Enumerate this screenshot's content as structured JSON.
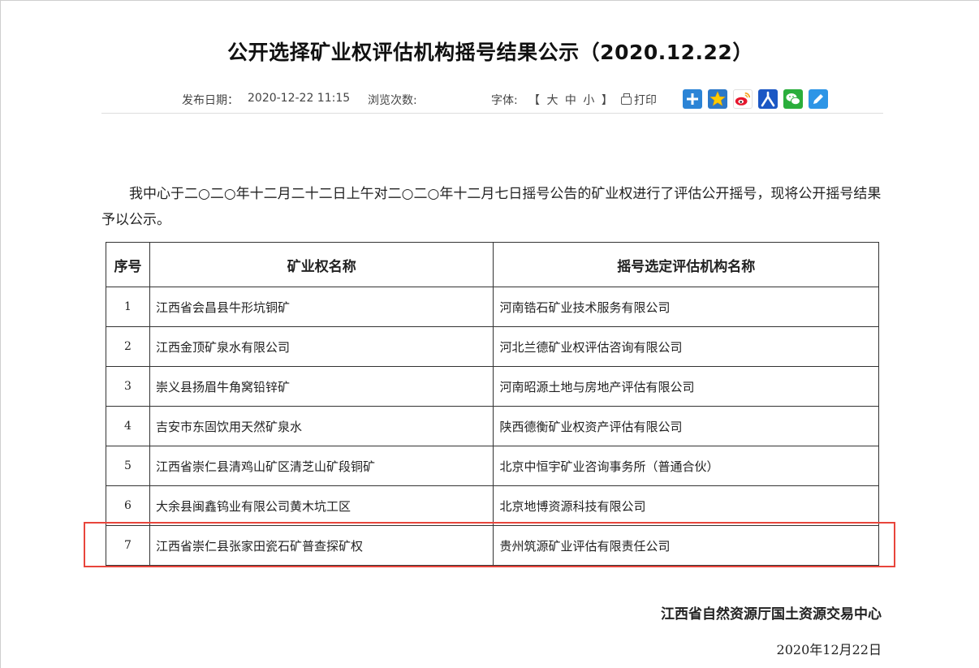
{
  "article": {
    "title": "公开选择矿业权评估机构摇号结果公示（2020.12.22）",
    "meta": {
      "date_label": "发布日期：",
      "date_value": "2020-12-22 11:15",
      "views_label": "浏览次数:",
      "font_label": "字体:",
      "font_sizes": [
        "【",
        "大",
        "中",
        "小",
        "】"
      ],
      "print_label": "打印",
      "share_icons": [
        {
          "name": "share-more-icon",
          "color": "#2b84d6"
        },
        {
          "name": "qzone-icon",
          "color": "#2b78c8"
        },
        {
          "name": "weibo-icon",
          "color": "#e6162d"
        },
        {
          "name": "people-icon",
          "color": "#1b57c4"
        },
        {
          "name": "wechat-icon",
          "color": "#2aae3c"
        },
        {
          "name": "edit-icon",
          "color": "#2d95e6"
        }
      ]
    },
    "intro": "我中心于二○二○年十二月二十二日上午对二○二○年十二月七日摇号公告的矿业权进行了评估公开摇号，现将公开摇号结果予以公示。",
    "table": {
      "headers": [
        "序号",
        "矿业权名称",
        "摇号选定评估机构名称"
      ],
      "rows": [
        [
          "1",
          "江西省会昌县牛形坑铜矿",
          "河南锆石矿业技术服务有限公司"
        ],
        [
          "2",
          "江西金顶矿泉水有限公司",
          "河北兰德矿业权评估咨询有限公司"
        ],
        [
          "3",
          "崇义县扬眉牛角窝铅锌矿",
          "河南昭源土地与房地产评估有限公司"
        ],
        [
          "4",
          "吉安市东固饮用天然矿泉水",
          "陕西德衡矿业权资产评估有限公司"
        ],
        [
          "5",
          "江西省崇仁县清鸡山矿区清芝山矿段铜矿",
          "北京中恒宇矿业咨询事务所（普通合伙）"
        ],
        [
          "6",
          "大余县闽鑫钨业有限公司黄木坑工区",
          "北京地博资源科技有限公司"
        ],
        [
          "7",
          "江西省崇仁县张家田瓷石矿普查探矿权",
          "贵州筑源矿业评估有限责任公司"
        ]
      ]
    },
    "signature": "江西省自然资源厅国土资源交易中心",
    "signature_date": "2020年12月22日",
    "highlight_color": "#e8453c"
  }
}
